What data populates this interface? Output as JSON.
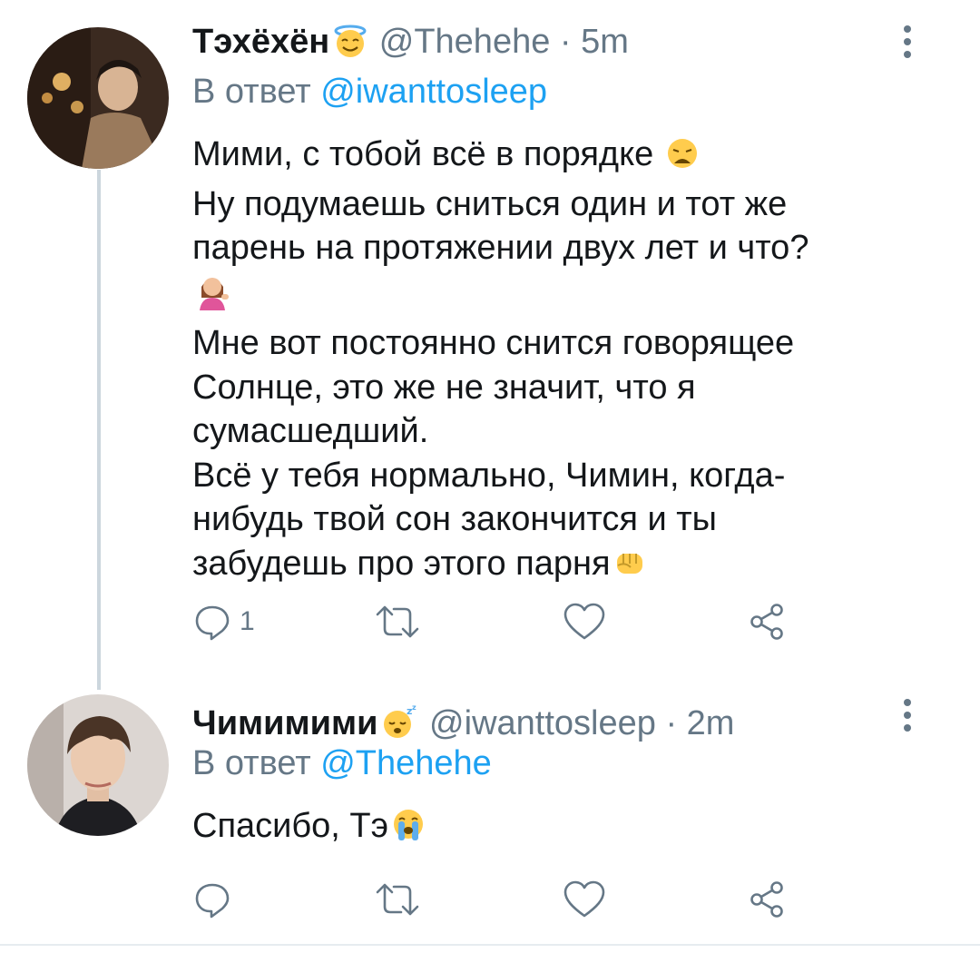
{
  "tweets": [
    {
      "author_name": "Тэхёхён",
      "author_emoji": "halo-face-emoji",
      "handle": "@Thehehe",
      "time": "· 5m",
      "reply_prefix": "В ответ",
      "reply_to": "@iwanttosleep",
      "lines": [
        "Мими, с тобой всё в порядке",
        "Ну подумаешь сниться один и тот же",
        "парень на протяжении двух лет и что?",
        "",
        "Мне вот постоянно снится говорящее",
        "Солнце, это же не значит, что я",
        "сумасшедший.",
        "Всё у тебя нормально, Чимин, когда-",
        "нибудь твой сон закончится и ты",
        "забудешь про этого парня"
      ],
      "reply_count": "1"
    },
    {
      "author_name": "Чимимими",
      "author_emoji": "sleeping-face-emoji",
      "handle": "@iwanttosleep",
      "time": "· 2m",
      "reply_prefix": "В ответ",
      "reply_to": "@Thehehe",
      "lines": [
        "Спасибо, Тэ"
      ],
      "reply_count": ""
    }
  ],
  "colors": {
    "text": "#14171a",
    "secondary": "#657786",
    "link": "#1da1f2",
    "thread_line": "#ccd6dd",
    "emoji_yellow": "#ffcc4d"
  }
}
